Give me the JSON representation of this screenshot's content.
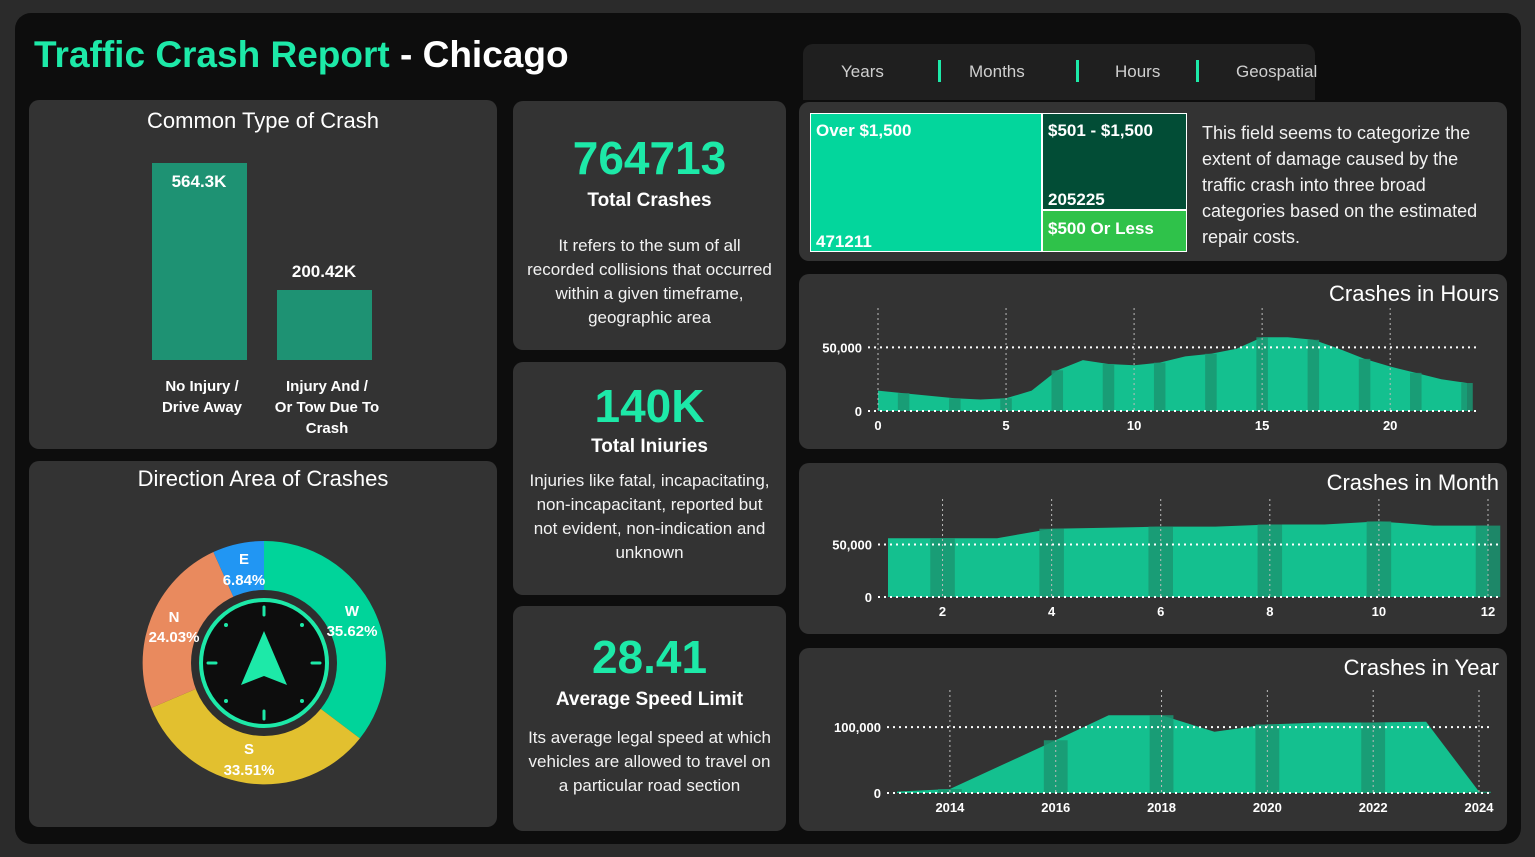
{
  "header": {
    "title_main": "Traffic Crash Report",
    "title_sep": " - ",
    "title_city": "Chicago"
  },
  "tabs": [
    "Years",
    "Months",
    "Hours",
    "Geospatial"
  ],
  "crash_type": {
    "title": "Common Type of Crash",
    "bars": [
      {
        "value_label": "564.3K",
        "line1": "No Injury /",
        "line2": "Drive Away",
        "line3": ""
      },
      {
        "value_label": "200.42K",
        "line1": "Injury And /",
        "line2": "Or Tow Due To",
        "line3": "Crash"
      }
    ]
  },
  "direction": {
    "title": "Direction Area of Crashes",
    "slices": [
      {
        "dir": "W",
        "pct": "35.62%",
        "color": "#00d49a"
      },
      {
        "dir": "S",
        "pct": "33.51%",
        "color": "#e2c02f"
      },
      {
        "dir": "N",
        "pct": "24.03%",
        "color": "#e98a5e"
      },
      {
        "dir": "E",
        "pct": "6.84%",
        "color": "#2196f3"
      }
    ]
  },
  "kpis": {
    "total_crashes": {
      "value": "764713",
      "label": "Total Crashes",
      "desc": "It refers to the sum of all recorded collisions that occurred within a given timeframe, geographic area"
    },
    "total_injuries": {
      "value": "140K",
      "label": "Total Iniuries",
      "desc": "Injuries like fatal, incapacitating, non-incapacitant, reported but not evident, non-indication and unknown"
    },
    "avg_speed": {
      "value": "28.41",
      "label": "Average Speed Limit",
      "desc": "Its average legal speed at which vehicles are allowed to travel on a particular road section"
    }
  },
  "damage": {
    "over_1500": {
      "label": "Over $1,500",
      "value": "471211"
    },
    "mid": {
      "label": "$501 - $1,500",
      "value": "205225"
    },
    "low": {
      "label": "$500 Or Less"
    },
    "desc": "This field seems to categorize the extent of damage caused by the traffic crash into three broad categories based on the estimated repair costs."
  },
  "colors": {
    "accent": "#1de9a8",
    "bar": "#1e9273",
    "area": "#14c08f",
    "area_dark": "#1a9672",
    "tm_big": "#03d69c",
    "tm_dark": "#024d36",
    "tm_green": "#2fc24a"
  },
  "chart_data": [
    {
      "type": "bar",
      "title": "Common Type of Crash",
      "categories": [
        "No Injury / Drive Away",
        "Injury And / Or Tow Due To Crash"
      ],
      "values": [
        564300,
        200420
      ]
    },
    {
      "type": "pie",
      "title": "Direction Area of Crashes",
      "categories": [
        "W",
        "S",
        "N",
        "E"
      ],
      "values": [
        35.62,
        33.51,
        24.03,
        6.84
      ]
    },
    {
      "type": "area",
      "title": "Crashes in Hours",
      "x": [
        0,
        1,
        2,
        3,
        4,
        5,
        6,
        7,
        8,
        9,
        10,
        11,
        12,
        13,
        14,
        15,
        16,
        17,
        18,
        19,
        20,
        21,
        22,
        23
      ],
      "values": [
        16000,
        14000,
        12000,
        10000,
        9000,
        10000,
        16000,
        32000,
        40000,
        37000,
        36000,
        38000,
        43000,
        45000,
        49000,
        58000,
        58000,
        56000,
        49000,
        41000,
        35000,
        30000,
        25000,
        22000
      ],
      "xticks": [
        0,
        5,
        10,
        15,
        20
      ],
      "yticks": [
        0,
        50000
      ],
      "ytick_labels": [
        "0",
        "50,000"
      ],
      "ylim": [
        0,
        70000
      ]
    },
    {
      "type": "area",
      "title": "Crashes in Month",
      "x": [
        1,
        2,
        3,
        4,
        5,
        6,
        7,
        8,
        9,
        10,
        11,
        12
      ],
      "values": [
        56000,
        56000,
        56000,
        65000,
        66000,
        67000,
        67000,
        69000,
        69000,
        72000,
        68000,
        68000
      ],
      "xticks": [
        2,
        4,
        6,
        8,
        10,
        12
      ],
      "yticks": [
        0,
        50000
      ],
      "ytick_labels": [
        "0",
        "50,000"
      ],
      "ylim": [
        0,
        80000
      ]
    },
    {
      "type": "area",
      "title": "Crashes in Year",
      "x": [
        2013,
        2014,
        2015,
        2016,
        2017,
        2018,
        2019,
        2020,
        2021,
        2022,
        2023,
        2024
      ],
      "values": [
        2000,
        6000,
        43000,
        80000,
        118000,
        118000,
        93000,
        104000,
        107000,
        107000,
        108000,
        2000
      ],
      "xticks": [
        2014,
        2016,
        2018,
        2020,
        2022,
        2024
      ],
      "yticks": [
        0,
        100000
      ],
      "ytick_labels": [
        "0",
        "100,000"
      ],
      "ylim": [
        0,
        135000
      ]
    }
  ]
}
